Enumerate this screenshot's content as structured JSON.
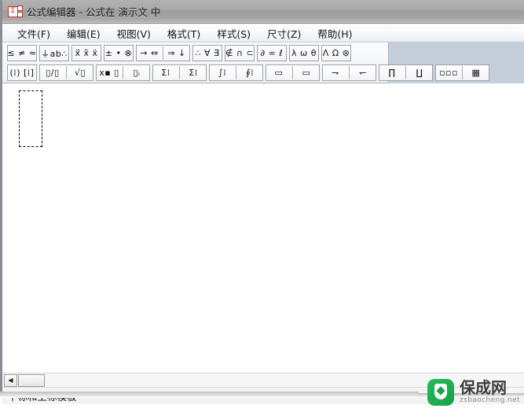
{
  "window": {
    "title": "公式编辑器 - 公式在 演示文 中",
    "icon": "equation-editor-icon"
  },
  "menubar": {
    "items": [
      {
        "label": "文件(F)",
        "name": "menu-file"
      },
      {
        "label": "编辑(E)",
        "name": "menu-edit"
      },
      {
        "label": "视图(V)",
        "name": "menu-view"
      },
      {
        "label": "格式(T)",
        "name": "menu-format"
      },
      {
        "label": "样式(S)",
        "name": "menu-style"
      },
      {
        "label": "尺寸(Z)",
        "name": "menu-size"
      },
      {
        "label": "帮助(H)",
        "name": "menu-help"
      }
    ]
  },
  "toolbar": {
    "row1": [
      {
        "label": "≤ ≠ ≈",
        "name": "relation-symbols-button"
      },
      {
        "label": "⏚ab∴",
        "name": "spaces-and-ellipses-button"
      },
      {
        "label": "x⃗ x̃ ẍ",
        "name": "embellishments-button"
      },
      {
        "label": "± • ⊗",
        "name": "operator-symbols-button"
      },
      {
        "label": "→ ⇔",
        "name": "arrow-symbols-button"
      },
      {
        "label": "⇒ ↓",
        "name": "arrow-symbols-2-button"
      },
      {
        "label": "∴ ∀ ∃",
        "name": "logical-symbols-button"
      },
      {
        "label": "∉ ∩ ⊂",
        "name": "set-theory-symbols-button"
      },
      {
        "label": "∂ ∞ ℓ",
        "name": "miscellaneous-symbols-button"
      },
      {
        "label": "λ ω θ",
        "name": "greek-lowercase-button"
      },
      {
        "label": "Λ Ω ⊛",
        "name": "greek-uppercase-button"
      }
    ],
    "row2": [
      {
        "label": "(⁞) [⁞]",
        "name": "fence-templates-button"
      },
      {
        "label": "▯/▯",
        "name": "fraction-template-button"
      },
      {
        "label": "√▯",
        "name": "radical-template-button"
      },
      {
        "label": "x▪ ▯",
        "name": "subscript-superscript-templates-button"
      },
      {
        "label": "▯ᵢ",
        "name": "underbar-overbar-templates-button"
      },
      {
        "label": "Σ⁞",
        "name": "summation-template-button"
      },
      {
        "label": "Σ⁞",
        "name": "summation-template-2-button"
      },
      {
        "label": "∫⁞",
        "name": "integral-template-button"
      },
      {
        "label": "∮⁞",
        "name": "contour-integral-template-button"
      },
      {
        "label": "▭",
        "name": "overbrace-template-button"
      },
      {
        "label": "▭",
        "name": "underbrace-template-button"
      },
      {
        "label": "⇁",
        "name": "labeled-arrow-template-button"
      },
      {
        "label": "↽",
        "name": "labeled-arrow-left-template-button"
      },
      {
        "label": "∏",
        "name": "product-template-button"
      },
      {
        "label": "∐",
        "name": "coproduct-template-button"
      },
      {
        "label": "▫▫▫",
        "name": "matrix-templates-button"
      },
      {
        "label": "▦",
        "name": "matrix-grid-templates-button"
      }
    ]
  },
  "canvas": {
    "slot_label": "empty-formula-slot"
  },
  "scrollbar": {
    "left_arrow": "◀"
  },
  "statusbar": {
    "text": "下标和上标模板"
  },
  "watermark": {
    "cn": "保成网",
    "en": "zsbaocheng.net"
  },
  "colors": {
    "titlebar": "#a8a8a8",
    "toolbar_surround": "#c4ced8",
    "canvas": "#ffffff",
    "watermark_green": "#16a34a"
  }
}
